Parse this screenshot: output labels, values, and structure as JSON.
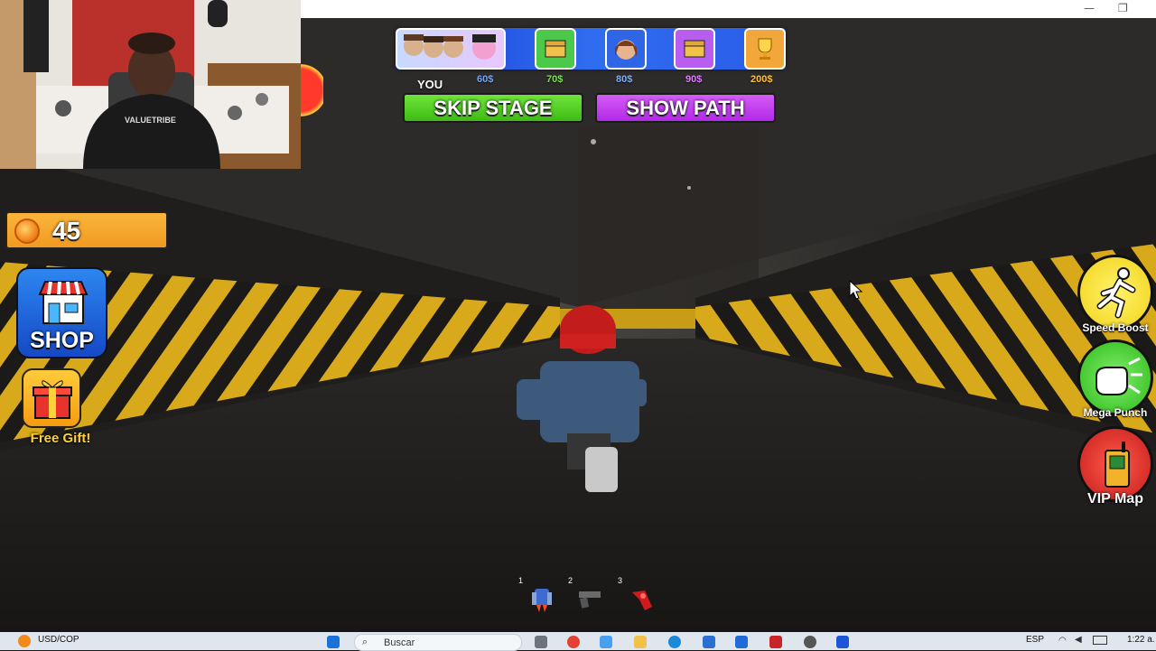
{
  "game_ui": {
    "you_label": "YOU",
    "prices": [
      "60$",
      "70$",
      "80$",
      "90$",
      "200$"
    ],
    "price_colors": [
      "#6fa8ff",
      "#7ee05a",
      "#7fb0ff",
      "#e07aff",
      "#ffc33a"
    ],
    "skip_stage_label": "SKIP STAGE",
    "show_path_label": "SHOW PATH",
    "coins": "45",
    "shop_label": "SHOP",
    "free_gift_label": "Free Gift!",
    "speed_boost_label": "Speed Boost",
    "mega_punch_label": "Mega Punch",
    "vip_map_label": "VIP Map",
    "hotbar_slots": [
      "1",
      "2",
      "3"
    ],
    "webcam_shirt_text": "VALUETRIBE"
  },
  "colors": {
    "skip_green": "#4cd11c",
    "show_path_purple": "#c43df2",
    "coin_orange": "#f5a52a",
    "hazard_yellow": "#e8b51a"
  },
  "taskbar": {
    "ticker_name": "USD/COP",
    "search_placeholder": "Buscar",
    "language": "ESP",
    "clock": "1:22 a."
  }
}
